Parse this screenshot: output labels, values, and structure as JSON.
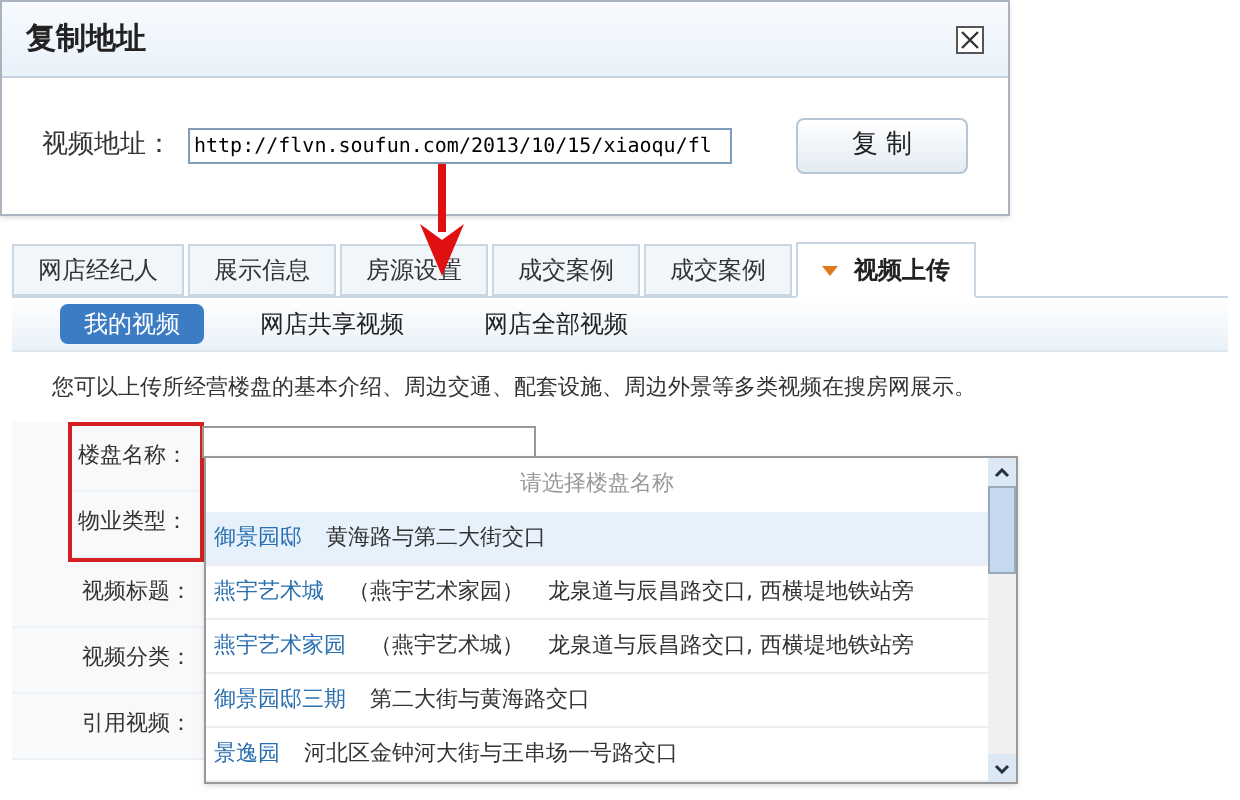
{
  "dialog": {
    "title": "复制地址",
    "field": {
      "label": "视频地址：",
      "value": "http://flvn.soufun.com/2013/10/15/xiaoqu/fl"
    },
    "button": "复 制"
  },
  "tabs": [
    {
      "label": "网店经纪人",
      "selected": false
    },
    {
      "label": "展示信息",
      "selected": false
    },
    {
      "label": "房源设置",
      "selected": false
    },
    {
      "label": "成交案例",
      "selected": false
    },
    {
      "label": "成交案例",
      "selected": false
    },
    {
      "label": "视频上传",
      "selected": true
    }
  ],
  "subtabs": [
    {
      "label": "我的视频",
      "selected": true
    },
    {
      "label": "网店共享视频",
      "selected": false
    },
    {
      "label": "网店全部视频",
      "selected": false
    }
  ],
  "notice": "您可以上传所经营楼盘的基本介绍、周边交通、配套设施、周边外景等多类视频在搜房网展示。",
  "form": {
    "labels": [
      {
        "label": "楼盘名称：",
        "highlighted": true
      },
      {
        "label": "物业类型：",
        "highlighted": true
      },
      {
        "label": "视频标题：",
        "highlighted": false
      },
      {
        "label": "视频分类：",
        "highlighted": false
      },
      {
        "label": "引用视频：",
        "highlighted": false
      }
    ]
  },
  "dropdown": {
    "header": "请选择楼盘名称",
    "options": [
      {
        "name": "御景园邸",
        "address": "黄海路与第二大街交口",
        "selected": true
      },
      {
        "name": "燕宇艺术城",
        "alias": "（燕宇艺术家园）",
        "address": "龙泉道与辰昌路交口, 西横堤地铁站旁",
        "selected": false
      },
      {
        "name": "燕宇艺术家园",
        "alias": "（燕宇艺术城）",
        "address": "龙泉道与辰昌路交口, 西横堤地铁站旁",
        "selected": false
      },
      {
        "name": "御景园邸三期",
        "address": "第二大街与黄海路交口",
        "selected": false
      },
      {
        "name": "景逸园",
        "address": "河北区金钟河大街与王串场一号路交口",
        "selected": false
      }
    ]
  }
}
